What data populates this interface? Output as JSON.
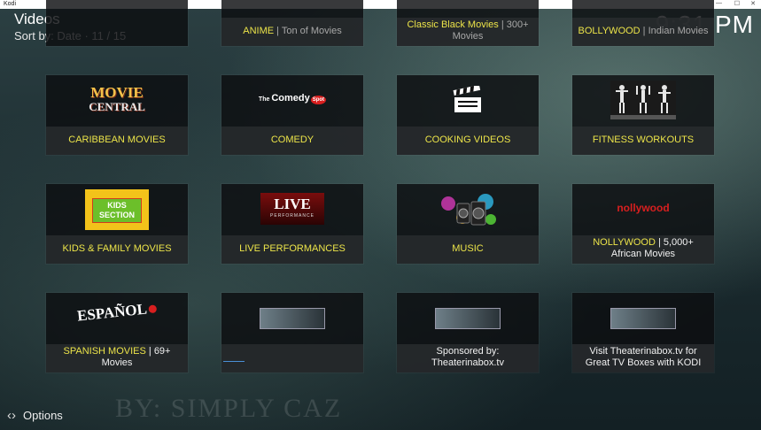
{
  "window": {
    "app_name": "Kodi",
    "min": "—",
    "max": "☐",
    "close": "✕"
  },
  "header": {
    "title": "Videos",
    "sort": "Sort by: Date  ·  11 / 15",
    "clock": "9:31 PM"
  },
  "top_row": [
    {
      "primary": "ANIME",
      "secondary": " | Ton of Movies"
    },
    {
      "primary": "Classic Black Movies",
      "secondary": " | 300+",
      "line2": "Movies"
    },
    {
      "primary": "BOLLYWOOD",
      "secondary": " | Indian Movies"
    }
  ],
  "tiles": [
    {
      "label": "CARIBBEAN MOVIES",
      "art_text": "MOVIE CENTRAL"
    },
    {
      "label": "COMEDY",
      "art_text": "The Comedy Spot"
    },
    {
      "label": "COOKING VIDEOS"
    },
    {
      "label": "FITNESS WORKOUTS"
    },
    {
      "label": "KIDS & FAMILY MOVIES",
      "art_text": "KIDS SECTION"
    },
    {
      "label": "LIVE PERFORMANCES",
      "art_text": "LIVE"
    },
    {
      "label": "MUSIC"
    },
    {
      "label": "NOLLYWOOD",
      "label_extra": " | 5,000+",
      "line2": "African Movies",
      "art_text": "nollywood"
    },
    {
      "label": "SPANISH MOVIES",
      "label_extra": " | 69+",
      "line2": "Movies",
      "art_text": "ESPAÑOL"
    },
    {
      "label": ""
    },
    {
      "label": "Sponsored by:",
      "line2": "Theaterinabox.tv"
    },
    {
      "label": "Visit Theaterinabox.tv for",
      "line2": "Great TV Boxes with KODI"
    }
  ],
  "footer": {
    "options": "Options"
  },
  "background": {
    "watermark": "BY: SIMPLY CAZ"
  },
  "colors": {
    "accent_yellow": "#ece449",
    "tile_bg": "#0c0e10",
    "text_gray": "#a8a8a8"
  }
}
